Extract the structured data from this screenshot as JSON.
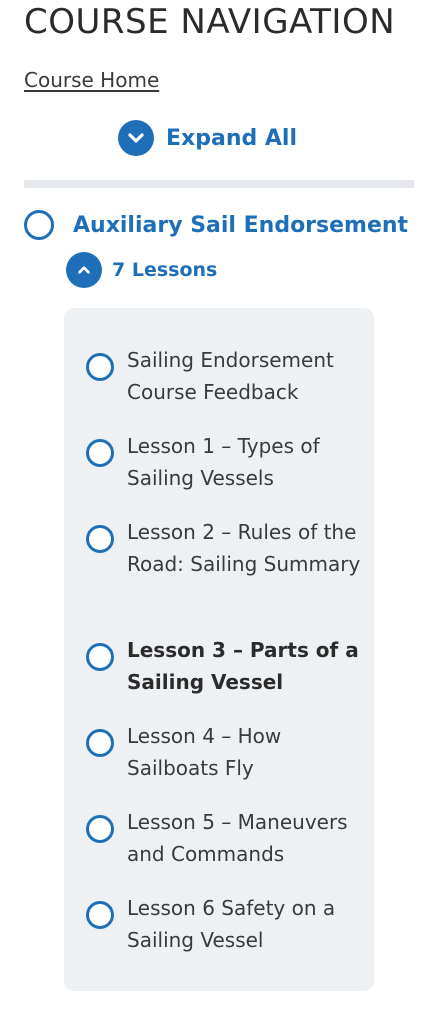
{
  "nav": {
    "title": "COURSE NAVIGATION",
    "course_home_link": "Course Home",
    "expand_all_label": "Expand All"
  },
  "course": {
    "title": "Auxiliary Sail Endorsement",
    "lessons_toggle_label": "7 Lessons",
    "lessons": [
      {
        "label": "Sailing Endorsement Course Feedback",
        "current": false
      },
      {
        "label": "Lesson 1 – Types of Sailing Vessels",
        "current": false
      },
      {
        "label": "Lesson 2 – Rules of the Road: Sailing Summary",
        "current": false
      },
      {
        "label": "Lesson 3 – Parts of a Sailing Vessel",
        "current": true
      },
      {
        "label": "Lesson 4 – How Sailboats Fly",
        "current": false
      },
      {
        "label": "Lesson 5 – Maneuvers and Commands",
        "current": false
      },
      {
        "label": "Lesson 6 Safety on a Sailing Vessel",
        "current": false
      }
    ]
  },
  "icons": {
    "expand": "chevron-down-icon",
    "collapse": "chevron-up-icon",
    "status": "circle-outline-icon"
  },
  "colors": {
    "accent": "#1f6fb8",
    "panel_bg": "#eef1f4",
    "divider": "#e3e6ea",
    "text": "#2b2b2b"
  }
}
